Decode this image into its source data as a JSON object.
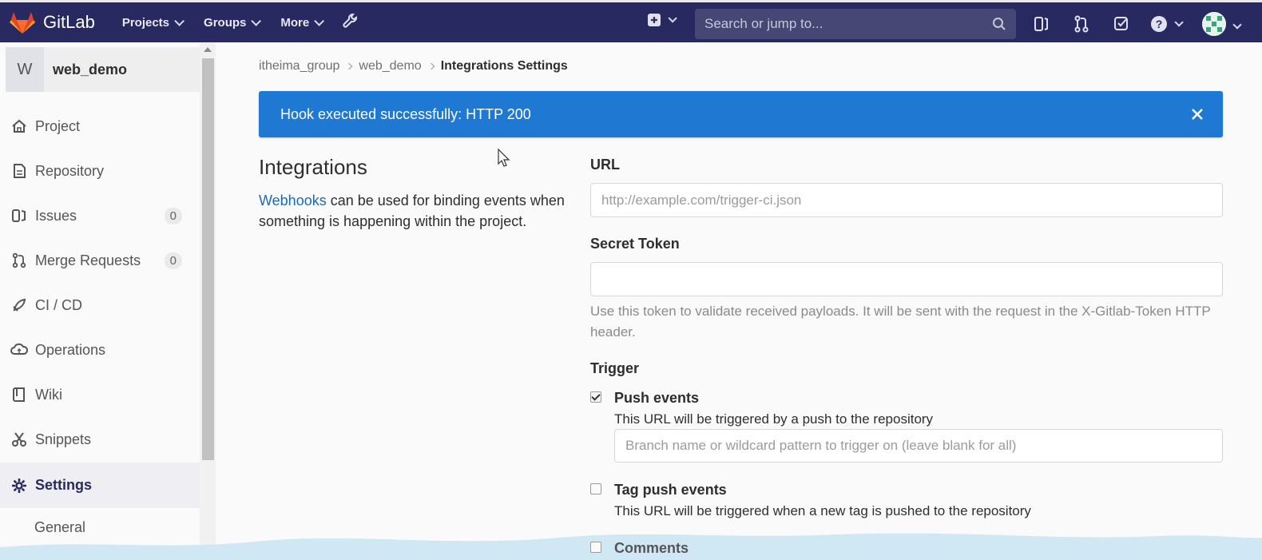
{
  "topbar": {
    "brand": "GitLab",
    "nav": [
      {
        "label": "Projects"
      },
      {
        "label": "Groups"
      },
      {
        "label": "More"
      }
    ],
    "search_placeholder": "Search or jump to..."
  },
  "sidebar": {
    "project_initial": "W",
    "project_name": "web_demo",
    "items": [
      {
        "label": "Project",
        "icon": "home-icon"
      },
      {
        "label": "Repository",
        "icon": "document-icon"
      },
      {
        "label": "Issues",
        "icon": "issues-icon",
        "count": "0"
      },
      {
        "label": "Merge Requests",
        "icon": "merge-request-icon",
        "count": "0"
      },
      {
        "label": "CI / CD",
        "icon": "rocket-icon"
      },
      {
        "label": "Operations",
        "icon": "cloud-icon"
      },
      {
        "label": "Wiki",
        "icon": "book-icon"
      },
      {
        "label": "Snippets",
        "icon": "scissors-icon"
      },
      {
        "label": "Settings",
        "icon": "gear-icon"
      }
    ],
    "sub_items": [
      {
        "label": "General"
      }
    ]
  },
  "breadcrumb": {
    "items": [
      "itheima_group",
      "web_demo",
      "Integrations Settings"
    ]
  },
  "flash": {
    "message": "Hook executed successfully: HTTP 200",
    "color": "#1f78d1"
  },
  "integrations": {
    "title": "Integrations",
    "link_text": "Webhooks",
    "description": " can be used for binding events when something is happening within the project."
  },
  "form": {
    "url_label": "URL",
    "url_placeholder": "http://example.com/trigger-ci.json",
    "token_label": "Secret Token",
    "token_value": "",
    "token_help": "Use this token to validate received payloads. It will be sent with the request in the X-Gitlab-Token HTTP header.",
    "trigger_label": "Trigger",
    "events": [
      {
        "title": "Push events",
        "description": "This URL will be triggered by a push to the repository",
        "checked": true
      },
      {
        "title": "Tag push events",
        "description": "This URL will be triggered when a new tag is pushed to the repository",
        "checked": false
      },
      {
        "title": "Comments",
        "description": "",
        "checked": false
      }
    ],
    "branch_placeholder": "Branch name or wildcard pattern to trigger on (leave blank for all)"
  },
  "colors": {
    "nav_bg": "#292961",
    "accent": "#1f78d1",
    "link": "#1b69b6"
  }
}
